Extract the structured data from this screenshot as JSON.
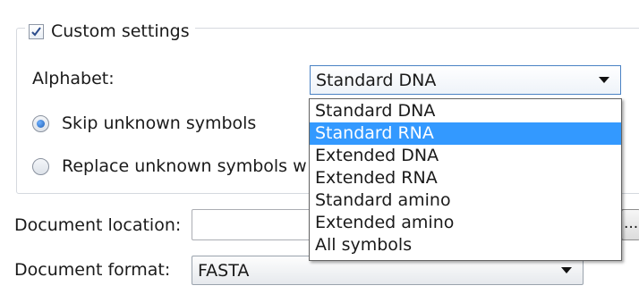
{
  "custom_settings": {
    "label": "Custom settings",
    "checked": true
  },
  "alphabet": {
    "label": "Alphabet:",
    "selected": "Standard DNA",
    "options": [
      "Standard DNA",
      "Standard RNA",
      "Extended DNA",
      "Extended RNA",
      "Standard amino",
      "Extended amino",
      "All symbols"
    ],
    "highlighted_index": 1
  },
  "unknown_symbols": {
    "skip_label": "Skip unknown symbols",
    "skip_checked": true,
    "replace_label": "Replace unknown symbols w",
    "replace_checked": false
  },
  "document_location": {
    "label": "Document location:",
    "value": "",
    "browse_label": "..."
  },
  "document_format": {
    "label": "Document format:",
    "selected": "FASTA"
  },
  "colors": {
    "highlight": "#3399ff",
    "highlight_text": "#ffffff"
  }
}
